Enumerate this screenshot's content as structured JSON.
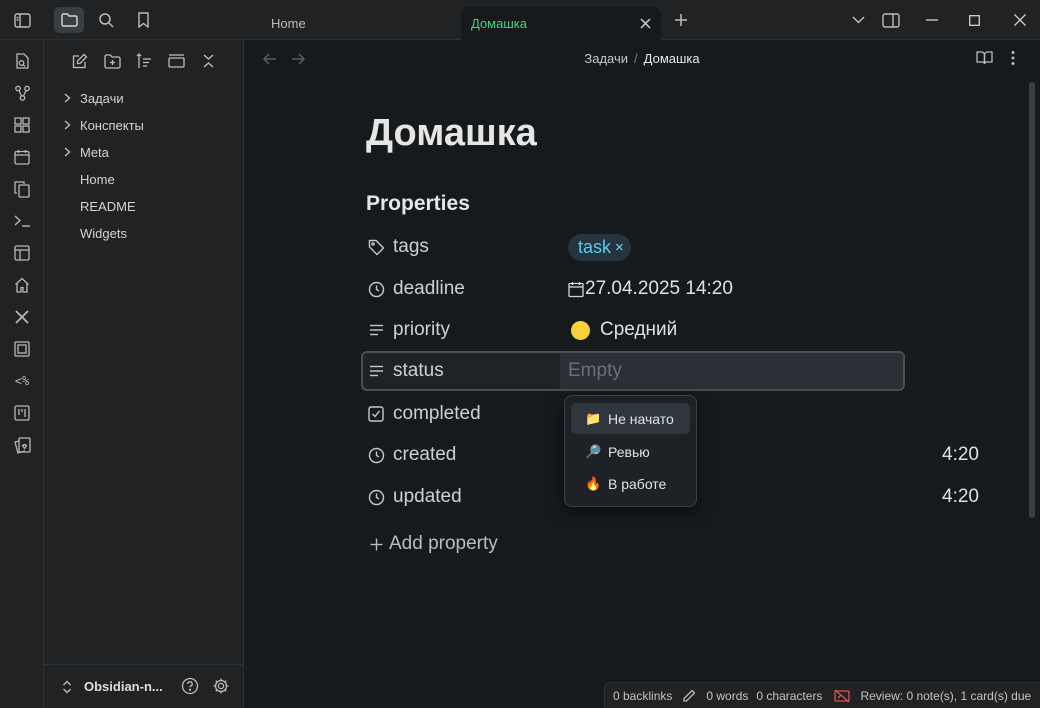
{
  "tabs": [
    {
      "label": "Home"
    },
    {
      "label": "Домашка"
    }
  ],
  "sidebar": {
    "tree": [
      {
        "label": "Задачи",
        "type": "folder"
      },
      {
        "label": "Конспекты",
        "type": "folder"
      },
      {
        "label": "Meta",
        "type": "folder"
      },
      {
        "label": "Home",
        "type": "file"
      },
      {
        "label": "README",
        "type": "file"
      },
      {
        "label": "Widgets",
        "type": "file"
      }
    ],
    "vault_name": "Obsidian-n..."
  },
  "breadcrumb": {
    "parent": "Задачи",
    "separator": "/",
    "current": "Домашка"
  },
  "document": {
    "title": "Домашка",
    "properties_heading": "Properties",
    "properties": [
      {
        "key": "tags",
        "icon": "tag-icon",
        "value": "task"
      },
      {
        "key": "deadline",
        "icon": "clock-icon",
        "value": "27.04.2025 14:20"
      },
      {
        "key": "priority",
        "icon": "list-icon",
        "value": "Средний"
      },
      {
        "key": "status",
        "icon": "list-icon",
        "placeholder": "Empty"
      },
      {
        "key": "completed",
        "icon": "checkbox-icon",
        "value": ""
      },
      {
        "key": "created",
        "icon": "clock-icon",
        "value": "4:20"
      },
      {
        "key": "updated",
        "icon": "clock-icon",
        "value": "4:20"
      }
    ],
    "add_property": "Add property"
  },
  "status_dropdown": {
    "options": [
      {
        "icon": "📁",
        "label": "Не начато"
      },
      {
        "icon": "🔎",
        "label": "Ревью"
      },
      {
        "icon": "🔥",
        "label": "В работе"
      }
    ]
  },
  "statusbar": {
    "backlinks": "0 backlinks",
    "words": "0 words",
    "characters": "0 characters",
    "review": "Review: 0 note(s), 1 card(s) due"
  },
  "colors": {
    "accent_tab": "#4ad07a",
    "tag": "#5fc7ef",
    "priority_dot": "#f7d23b"
  }
}
